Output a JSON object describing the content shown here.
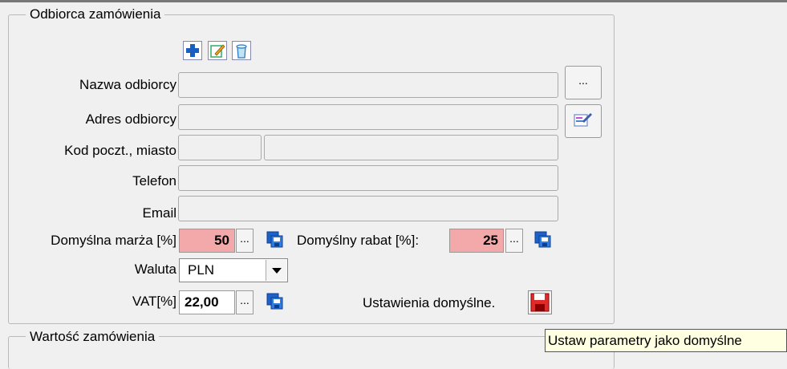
{
  "recipient_group": {
    "title": "Odbiorca zamówienia",
    "name_label": "Nazwa odbiorcy",
    "address_label": "Adres odbiorcy",
    "postal_city_label": "Kod poczt., miasto",
    "phone_label": "Telefon",
    "email_label": "Email",
    "name_value": "",
    "address_value": "",
    "postal_value": "",
    "city_value": "",
    "phone_value": "",
    "email_value": "",
    "browse_label": "...",
    "icons": [
      "add-icon",
      "edit-icon",
      "delete-icon",
      "address-book-icon"
    ]
  },
  "defaults": {
    "margin_label": "Domyślna marża [%]",
    "margin_value": "50",
    "discount_label": "Domyślny rabat [%]:",
    "discount_value": "25",
    "currency_label": "Waluta",
    "currency_value": "PLN",
    "vat_label": "VAT[%]",
    "vat_value": "22,00",
    "dots": "...",
    "settings_label": "Ustawienia domyślne.",
    "colors": {
      "required_bg": "#f3a9a9"
    }
  },
  "order_value_group": {
    "title": "Wartość zamówienia"
  },
  "tooltip": {
    "text": "Ustaw parametry jako domyślne"
  }
}
